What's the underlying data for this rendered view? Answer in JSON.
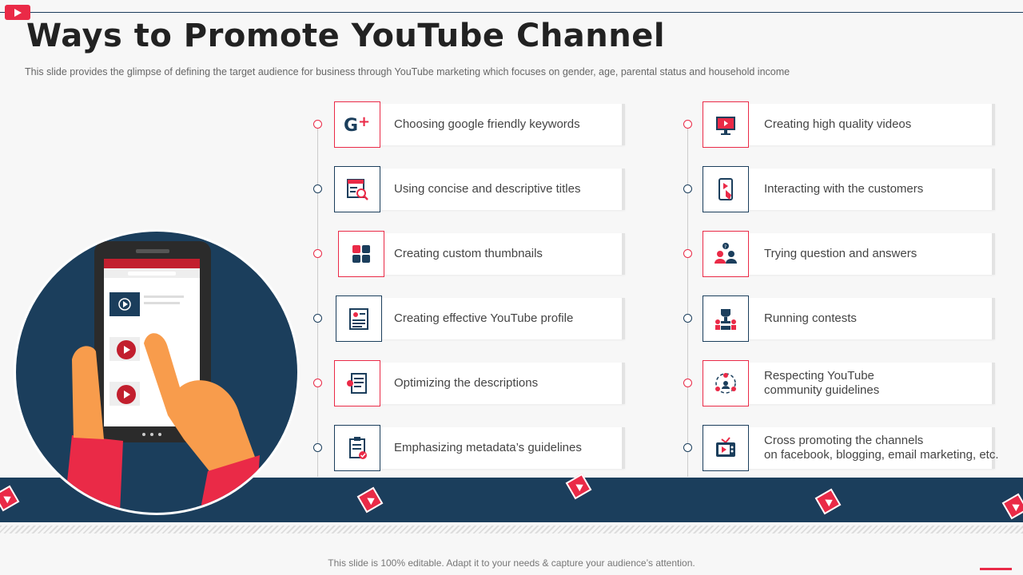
{
  "title": "Ways to Promote YouTube Channel",
  "subtitle": "This slide provides  the glimpse of defining the target audience for business through YouTube  marketing which focuses on gender,  age,  parental status and household income",
  "left_items": [
    {
      "label": "Choosing google friendly keywords",
      "icon": "google-plus-icon",
      "accent": "red"
    },
    {
      "label": "Using concise and descriptive titles",
      "icon": "title-search-icon",
      "accent": "blue"
    },
    {
      "label": "Creating custom thumbnails",
      "icon": "thumbnail-grid-icon",
      "accent": "red"
    },
    {
      "label": "Creating effective YouTube profile",
      "icon": "profile-icon",
      "accent": "blue"
    },
    {
      "label": "Optimizing the descriptions",
      "icon": "description-icon",
      "accent": "red"
    },
    {
      "label": "Emphasizing metadata’s guidelines",
      "icon": "clipboard-icon",
      "accent": "blue"
    }
  ],
  "right_items": [
    {
      "label": "Creating high quality videos",
      "icon": "monitor-video-icon",
      "accent": "red"
    },
    {
      "label": "Interacting with the customers",
      "icon": "touch-video-icon",
      "accent": "blue"
    },
    {
      "label": "Trying question and answers",
      "icon": "qa-people-icon",
      "accent": "red"
    },
    {
      "label": "Running contests",
      "icon": "trophy-icon",
      "accent": "blue"
    },
    {
      "label": "Respecting YouTube\ncommunity guidelines",
      "icon": "community-icon",
      "accent": "red"
    },
    {
      "label": "Cross promoting the channels\non facebook, blogging, email marketing, etc.",
      "icon": "tv-icon",
      "accent": "blue"
    }
  ],
  "footer": "This slide is 100% editable. Adapt it to your needs & capture your audience’s attention.",
  "colors": {
    "accent_red": "#ea2a47",
    "accent_blue": "#1b3e5c"
  }
}
